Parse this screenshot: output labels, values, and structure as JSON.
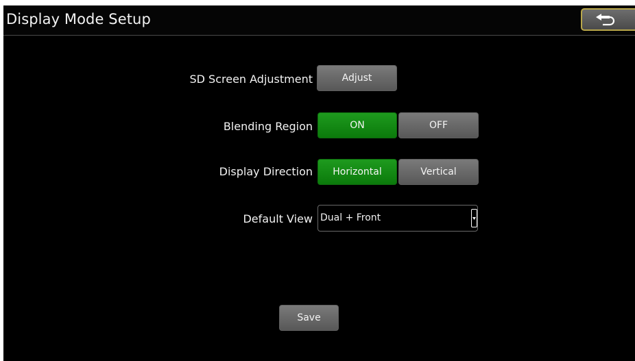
{
  "header": {
    "title": "Display Mode Setup",
    "back_icon": "back-arrow-icon"
  },
  "settings": {
    "sd_screen_adjustment": {
      "label": "SD Screen Adjustment",
      "button_label": "Adjust"
    },
    "blending_region": {
      "label": "Blending Region",
      "options": [
        "ON",
        "OFF"
      ],
      "selected": "ON"
    },
    "display_direction": {
      "label": "Display Direction",
      "options": [
        "Horizontal",
        "Vertical"
      ],
      "selected": "Horizontal"
    },
    "default_view": {
      "label": "Default View",
      "value": "Dual + Front",
      "dropdown_icon": "chevron-down-icon"
    }
  },
  "footer": {
    "save_label": "Save"
  },
  "colors": {
    "background": "#000000",
    "selected": "#118a11",
    "unselected": "#6a6a6a",
    "back_button_border": "#b9a74a"
  }
}
